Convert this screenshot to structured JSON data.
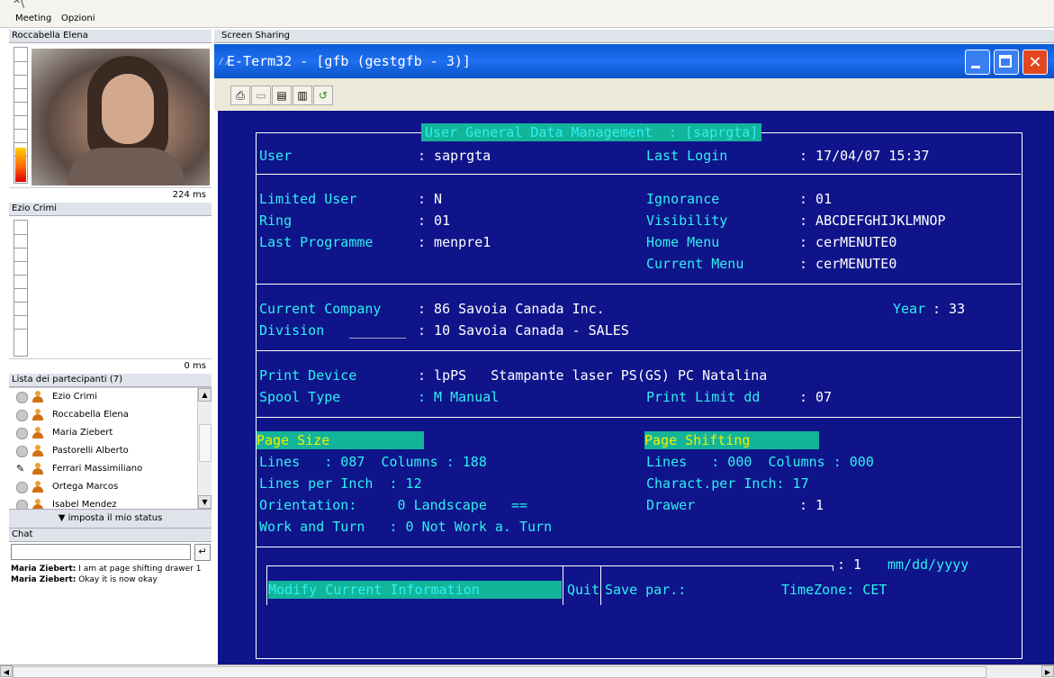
{
  "menu": {
    "items": [
      "Meeting",
      "Opzioni"
    ]
  },
  "left_panel": {
    "video1": {
      "name": "Roccabella Elena",
      "latency": "224 ms"
    },
    "video2": {
      "name": "Ezio Crimi",
      "latency": "0 ms"
    },
    "participants": {
      "title": "Lista dei partecipanti (7)",
      "people": [
        "Ezio Crimi",
        "Roccabella Elena",
        "Maria Ziebert",
        "Pastorelli Alberto",
        "Ferrari Massimiliano",
        "Ortega Marcos",
        "Isabel Mendez"
      ]
    },
    "status_button": "▼ imposta il mio status",
    "chat": {
      "title": "Chat",
      "input_value": "",
      "send_icon": "enter-icon",
      "messages": [
        {
          "author": "Maria Ziebert:",
          "text": " I am at page shifting drawer 1"
        },
        {
          "author": "Maria Ziebert:",
          "text": " Okay it is now okay"
        }
      ]
    }
  },
  "screen_sharing": {
    "title": "Screen Sharing",
    "window_title": "E-Term32 - [gfb (gestgfb - 3)]",
    "buttons": {
      "minimize": "minimize-icon",
      "maximize": "maximize-icon",
      "close": "close-icon"
    }
  },
  "terminal": {
    "header": "User General Data Management  : [saprgta]",
    "user_label": "User",
    "user_value": ": saprgta",
    "last_login_label": "Last Login",
    "last_login_value": ": 17/04/07 15:37",
    "limited_user_label": "Limited User",
    "limited_user_value": ": N",
    "ring_label": "Ring",
    "ring_value": ": 01",
    "last_programme_label": "Last Programme",
    "last_programme_value": ": menpre1",
    "ignorance_label": "Ignorance",
    "ignorance_value": ": 01",
    "visibility_label": "Visibility",
    "visibility_value": ": ABCDEFGHIJKLMNOP",
    "home_menu_label": "Home Menu",
    "home_menu_value": ": cerMENUTE0",
    "current_menu_label": "Current Menu",
    "current_menu_value": ": cerMENUTE0",
    "current_company_label": "Current Company",
    "current_company_value": ": 86 Savoia Canada Inc.",
    "year_label": "Year",
    "year_value": ": 33",
    "division_label": "Division",
    "division_blank": "_______",
    "division_value": ": 10 Savoia Canada - SALES",
    "print_device_label": "Print Device",
    "print_device_value": ": lpPS   Stampante laser PS(GS) PC Natalina",
    "spool_type_label": "Spool Type",
    "spool_type_value": ": M Manual",
    "print_limit_label": "Print Limit dd",
    "print_limit_value": ": 07",
    "page_size_label": "Page Size",
    "page_shifting_label": "Page Shifting",
    "ps_lines": "Lines   : 087  Columns : 188",
    "ps_lpi": "Lines per Inch  : 12",
    "ps_orient": "Orientation:     0 Landscape   ==",
    "ps_work": "Work and Turn   : 0 Not Work a. Turn",
    "sh_lines": "Lines   : 000  Columns : 000",
    "sh_cpi": "Charact.per Inch: 17",
    "sh_drawer_label": "Drawer",
    "sh_drawer_value": ": 1",
    "format_count": ": 1",
    "date_format": "mm/dd/yyyy",
    "modify_button": "Modify Current Information",
    "quit_button": "Quit",
    "save_label": "Save par.:",
    "timezone": "TimeZone: CET"
  }
}
